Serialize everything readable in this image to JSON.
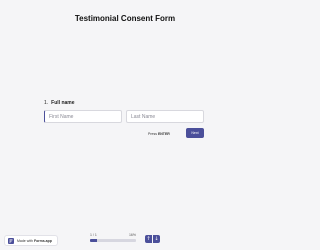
{
  "form": {
    "title": "Testimonial Consent Form",
    "question_number": "1.",
    "question_label": "Full name",
    "first_name": {
      "value": "",
      "placeholder": "First Name"
    },
    "last_name": {
      "value": "",
      "placeholder": "Last Name"
    },
    "press_prefix": "Press",
    "press_key": "ENTER",
    "next_label": "Next"
  },
  "footer": {
    "badge_prefix": "Made with",
    "badge_brand": "Forms.app",
    "progress_count": "1 / 1",
    "progress_percent_label": "16%",
    "progress_fraction": 0.16,
    "accent": "#4b4f9a"
  },
  "icons": {
    "up": "chevron-up-icon",
    "down": "chevron-down-icon",
    "logo": "forms-app-logo-icon"
  }
}
